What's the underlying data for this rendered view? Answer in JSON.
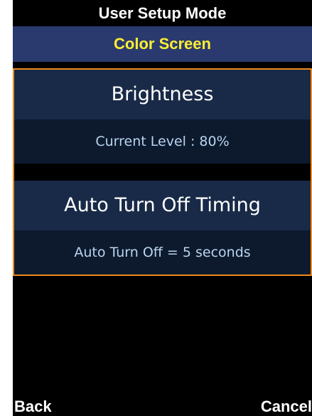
{
  "header": {
    "title": "User Setup Mode",
    "subtitle": "Color Screen"
  },
  "settings": [
    {
      "name": "Brightness",
      "value": "Current Level : 80%"
    },
    {
      "name": "Auto Turn Off Timing",
      "value": "Auto Turn Off = 5 seconds"
    }
  ],
  "softkeys": {
    "left": "Back",
    "right": "Cancel"
  },
  "colors": {
    "subtitle_bar": "#2a3a6e",
    "subtitle_text": "#ffee33",
    "selection_border": "#f08a1a",
    "setting_header": "#182a47",
    "setting_value": "#0d1a2e"
  }
}
